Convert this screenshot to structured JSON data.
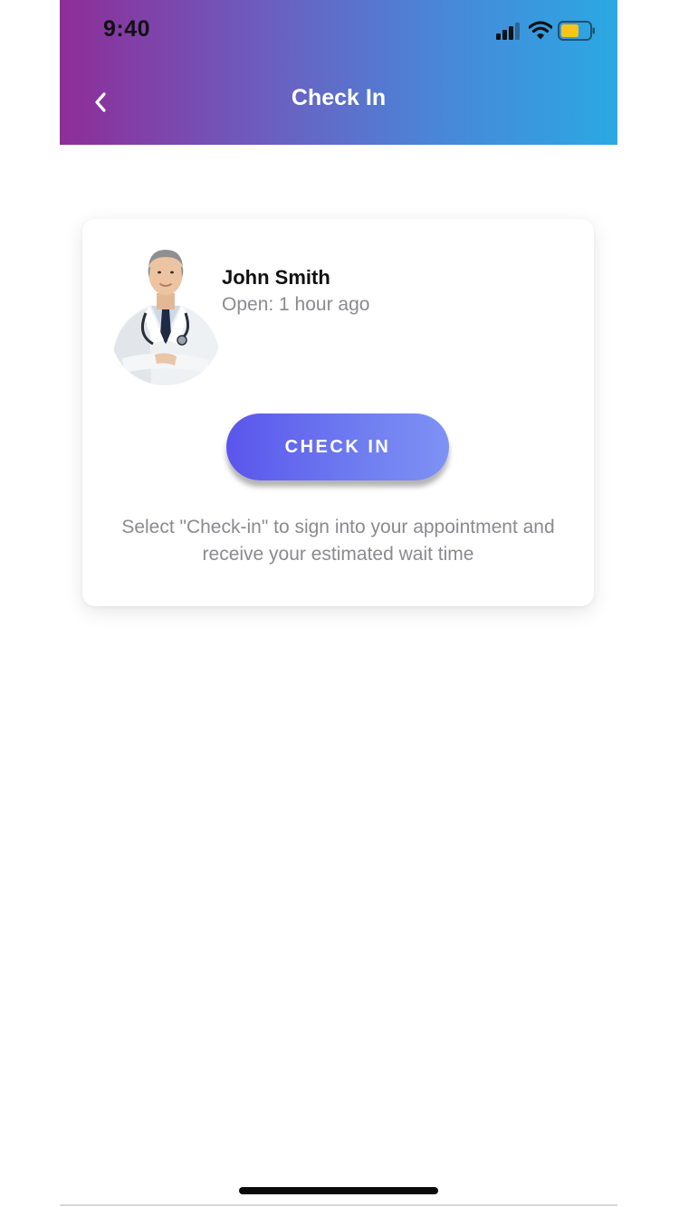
{
  "status_bar": {
    "time": "9:40",
    "icons": [
      "signal-icon",
      "wifi-icon",
      "battery-icon"
    ],
    "battery_color": "#f5c518"
  },
  "nav": {
    "title": "Check In",
    "back_icon": "chevron-left-icon"
  },
  "card": {
    "avatar": "doctor-avatar",
    "name": "John Smith",
    "status": "Open: 1 hour ago",
    "button_label": "CHECK IN",
    "instructions": "Select \"Check-in\" to sign into your appointment and receive your estimated wait time"
  },
  "colors": {
    "header_gradient": [
      "#8e2d98",
      "#6b5fc0",
      "#4a86d8",
      "#2aa9e3"
    ],
    "button_gradient": [
      "#5a55ec",
      "#7e92f4"
    ],
    "secondary_text": "#8a8a8f"
  }
}
